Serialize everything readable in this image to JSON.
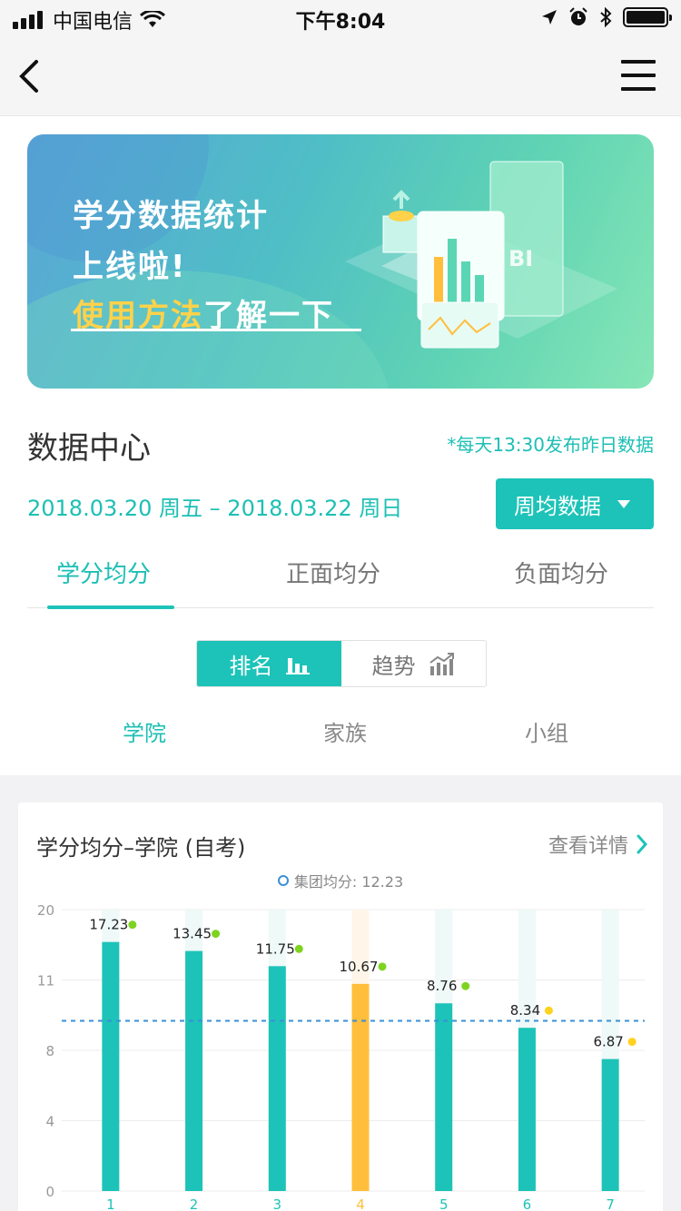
{
  "status_bar": {
    "carrier": "中国电信",
    "time": "下午8:04"
  },
  "banner": {
    "line1": "学分数据统计",
    "line2": "上线啦!",
    "line3_highlight": "使用方法",
    "line3_rest": "了解一下",
    "art_label": "BI"
  },
  "section": {
    "title": "数据中心",
    "publish_note": "*每天13:30发布昨日数据",
    "date_range": "2018.03.20 周五 – 2018.03.22 周日",
    "period_button": "周均数据"
  },
  "tabs": [
    {
      "label": "学分均分",
      "active": true
    },
    {
      "label": "正面均分",
      "active": false
    },
    {
      "label": "负面均分",
      "active": false
    }
  ],
  "segment": {
    "rank_label": "排名",
    "trend_label": "趋势",
    "active": "rank"
  },
  "subtabs": [
    {
      "label": "学院",
      "active": true
    },
    {
      "label": "家族",
      "active": false
    },
    {
      "label": "小组",
      "active": false
    }
  ],
  "card": {
    "title": "学分均分–学院 (自考)",
    "detail_link": "查看详情",
    "legend_label": "集团均分: 12.23"
  },
  "colors": {
    "accent": "#1dc3b8",
    "highlight": "#ffbe3c",
    "dot_green": "#7ed321",
    "dot_yellow": "#ffd21f"
  },
  "chart_data": {
    "type": "bar",
    "categories": [
      "1",
      "2",
      "3",
      "4",
      "5",
      "6",
      "7"
    ],
    "values": [
      17.23,
      13.45,
      11.75,
      10.67,
      8.76,
      8.34,
      6.87
    ],
    "labels": [
      "17.23",
      "13.45",
      "11.75",
      "10.67",
      "8.76",
      "8.34",
      "6.87"
    ],
    "bar_heights_ratio": [
      0.885,
      0.853,
      0.799,
      0.736,
      0.667,
      0.58,
      0.469
    ],
    "highlight_index": 3,
    "dot_colors": [
      "green",
      "green",
      "green",
      "green",
      "green",
      "yellow",
      "yellow"
    ],
    "y_ticks": [
      "20",
      "11",
      "8",
      "4",
      "0"
    ],
    "reference_line": {
      "label": "集团均分",
      "value": 12.23,
      "ratio": 0.605
    },
    "grid": true
  }
}
